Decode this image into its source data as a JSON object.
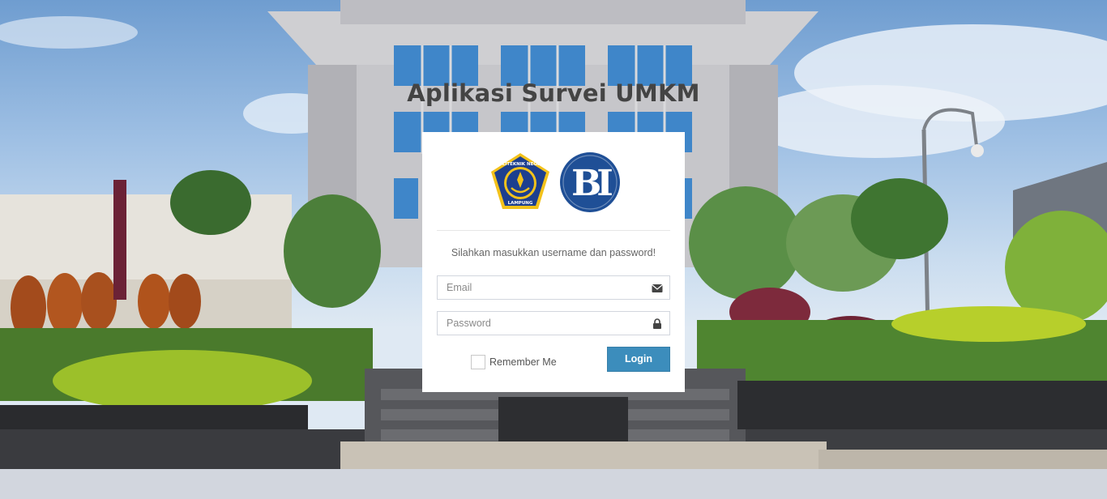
{
  "app_title": "Aplikasi Survei UMKM",
  "login_box": {
    "message": "Silahkan masukkan username dan password!",
    "logos": {
      "left": {
        "name": "politeknik-negeri-lampung-logo",
        "text_top": "POLITEKNIK NEGERI",
        "text_bottom": "LAMPUNG"
      },
      "right": {
        "name": "bank-indonesia-logo",
        "text": "BI"
      }
    },
    "email": {
      "placeholder": "Email",
      "value": "",
      "icon": "envelope-icon"
    },
    "password": {
      "placeholder": "Password",
      "value": "",
      "icon": "lock-icon"
    },
    "remember_label": "Remember Me",
    "remember_checked": false,
    "login_label": "Login"
  },
  "colors": {
    "primary_button": "#3c8dbc",
    "title_text": "#444444",
    "page_bottom": "#d2d6de"
  }
}
